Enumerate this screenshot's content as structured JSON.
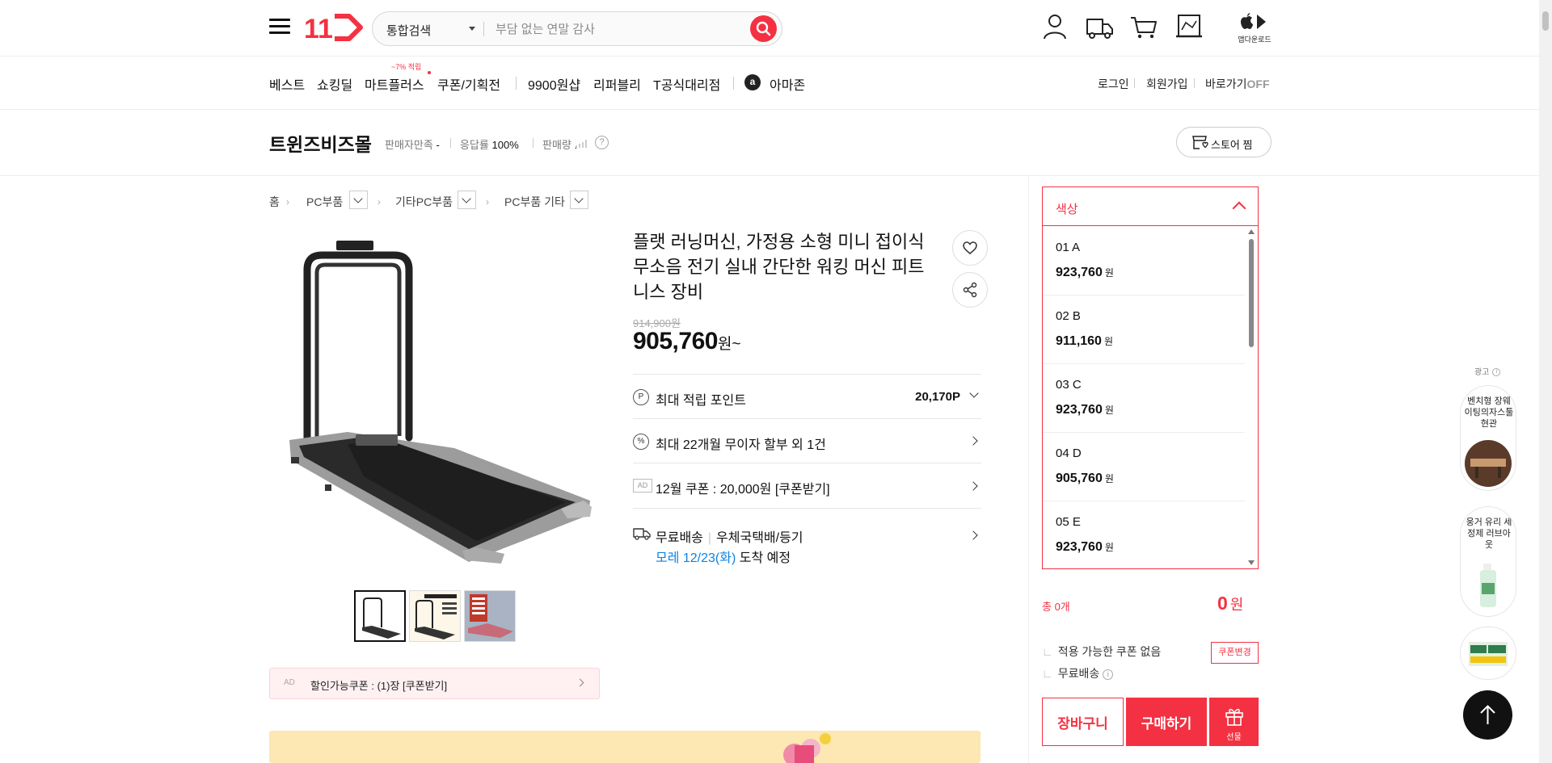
{
  "header": {
    "logo_text": "11",
    "search_scope": "통합검색",
    "search_placeholder": "부담 없는 연말 감사",
    "app_download_label": "앱다운로드"
  },
  "gnb": {
    "items": [
      "베스트",
      "쇼킹딜",
      "마트플러스",
      "쿠폰/기획전",
      "9900원샵",
      "리퍼블리",
      "T공식대리점",
      "아마존"
    ],
    "mart_badge": "~7% 적립",
    "amazon_logo_letter": "a",
    "util": {
      "login": "로그인",
      "signup": "회원가입",
      "quick_view": "바로가기",
      "quick_view_state": "OFF"
    }
  },
  "store": {
    "name": "트윈즈비즈몰",
    "satisfaction_label": "판매자만족",
    "satisfaction_value": "-",
    "response_label": "응답률",
    "response_value": "100%",
    "sales_label": "판매량",
    "sales_value": ".",
    "help_glyph": "?",
    "fav_button": "스토어 찜"
  },
  "breadcrumb": [
    "홈",
    "PC부품",
    "기타PC부품",
    "PC부품 기타"
  ],
  "product": {
    "title": "플랫 러닝머신, 가정용 소형 미니 접이식 무소음 전기 실내 간단한 워킹 머신 피트니스 장비",
    "original_price": "914,900원",
    "sale_price": "905,760",
    "sale_price_unit": "원~",
    "point_icon": "P",
    "point_label": "최대 적립 포인트",
    "point_value": "20,170P",
    "installment_icon": "%",
    "installment_label": "최대 22개월 무이자 할부 외 1건",
    "ad_tag": "AD",
    "coupon_label": "12월 쿠폰 : 20,000원 [쿠폰받기]",
    "delivery_label": "무료배송",
    "delivery_method": "우체국택배/등기",
    "delivery_eta_highlight": "모레 12/23(화)",
    "delivery_eta_suffix": "도착 예정",
    "discount_coupon_ad": "AD",
    "discount_coupon": "할인가능쿠폰 : (1)장 [쿠폰받기]"
  },
  "options": {
    "header": "색상",
    "items": [
      {
        "name": "01 A",
        "price": "923,760",
        "unit": "원"
      },
      {
        "name": "02 B",
        "price": "911,160",
        "unit": "원"
      },
      {
        "name": "03 C",
        "price": "923,760",
        "unit": "원"
      },
      {
        "name": "04 D",
        "price": "905,760",
        "unit": "원"
      },
      {
        "name": "05 E",
        "price": "923,760",
        "unit": "원"
      }
    ]
  },
  "order": {
    "total_count": "총 0개",
    "total_price": "0",
    "total_unit": "원",
    "coupon_none": "적용 가능한 쿠폰 없음",
    "coupon_change": "쿠폰변경",
    "free_shipping": "무료배송",
    "info_glyph": "i",
    "cart_button": "장바구니",
    "buy_button": "구매하기",
    "gift_button": "선물"
  },
  "side_ads": {
    "label": "광고",
    "info_glyph": "i",
    "items": [
      {
        "title": "벤치형 장웨이팅의자스툴 현관"
      },
      {
        "title": "웅거 유리 세정제 러브아웃"
      },
      {
        "title": ""
      }
    ]
  },
  "colors": {
    "brand_red": "#f43142",
    "link_blue": "#0b83e6"
  }
}
